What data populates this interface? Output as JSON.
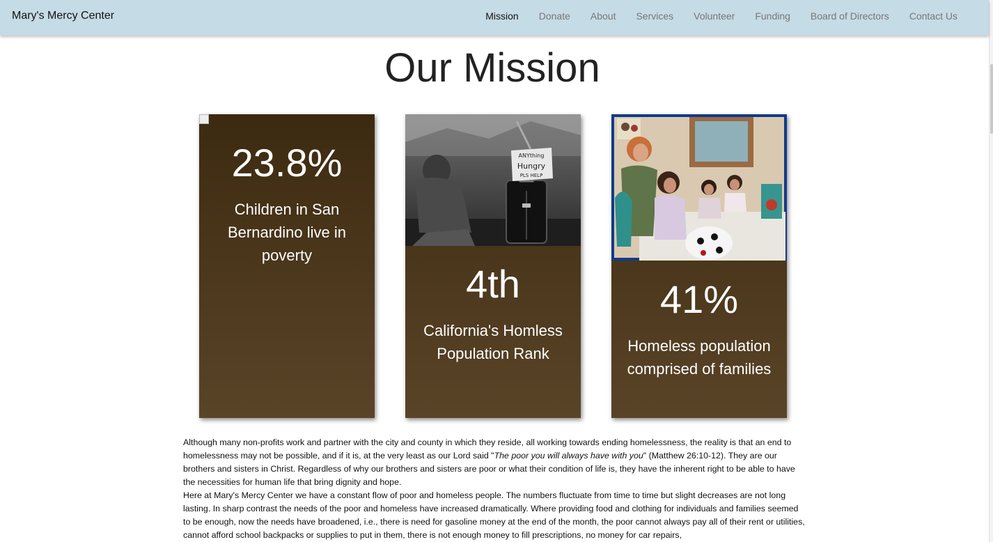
{
  "navbar": {
    "brand": "Mary's Mercy Center",
    "links": [
      {
        "label": "Mission",
        "active": true
      },
      {
        "label": "Donate"
      },
      {
        "label": "About"
      },
      {
        "label": "Services"
      },
      {
        "label": "Volunteer"
      },
      {
        "label": "Funding"
      },
      {
        "label": "Board of Directors"
      },
      {
        "label": "Contact Us"
      }
    ],
    "background_color": "#c5dbe6"
  },
  "main": {
    "title": "Our Mission",
    "cards": [
      {
        "stat": "23.8%",
        "description": "Children in San Bernardino live in poverty"
      },
      {
        "stat": "4th",
        "description": "California's Homless Population Rank",
        "image_sign": "ANYthing Hungry",
        "image_sign_line3": "PLS HELP"
      },
      {
        "stat": "41%",
        "description": "Homeless population comprised of families"
      }
    ],
    "paragraph1": {
      "before_quote": "Although many non-profits work and partner with the city and county in which they reside, all working towards ending homelessness, the reality is that an end to homelessness may not be possible, and if it is, at the very least as our Lord said \"",
      "quote": "The poor you will always have with you",
      "after_quote": "\" (Matthew 26:10-12). They are our brothers and sisters in Christ. Regardless of why our brothers and sisters are poor or what their condition of life is, they have the inherent right to be able to have the necessities for human life that bring dignity and hope."
    },
    "paragraph2": "Here at Mary's Mercy Center we have a constant flow of poor and homeless people. The numbers fluctuate from time to time but slight decreases are not long lasting. In sharp contrast the needs of the poor and homeless have increased dramatically. Where providing food and clothing for individuals and families seemed to be enough, now the needs have broadened, i.e., there is need for gasoline money at the end of the month, the poor cannot always pay all of their rent or utilities, cannot afford school backpacks or supplies to put in them, there is not enough money to fill prescriptions, no money for car repairs,"
  }
}
